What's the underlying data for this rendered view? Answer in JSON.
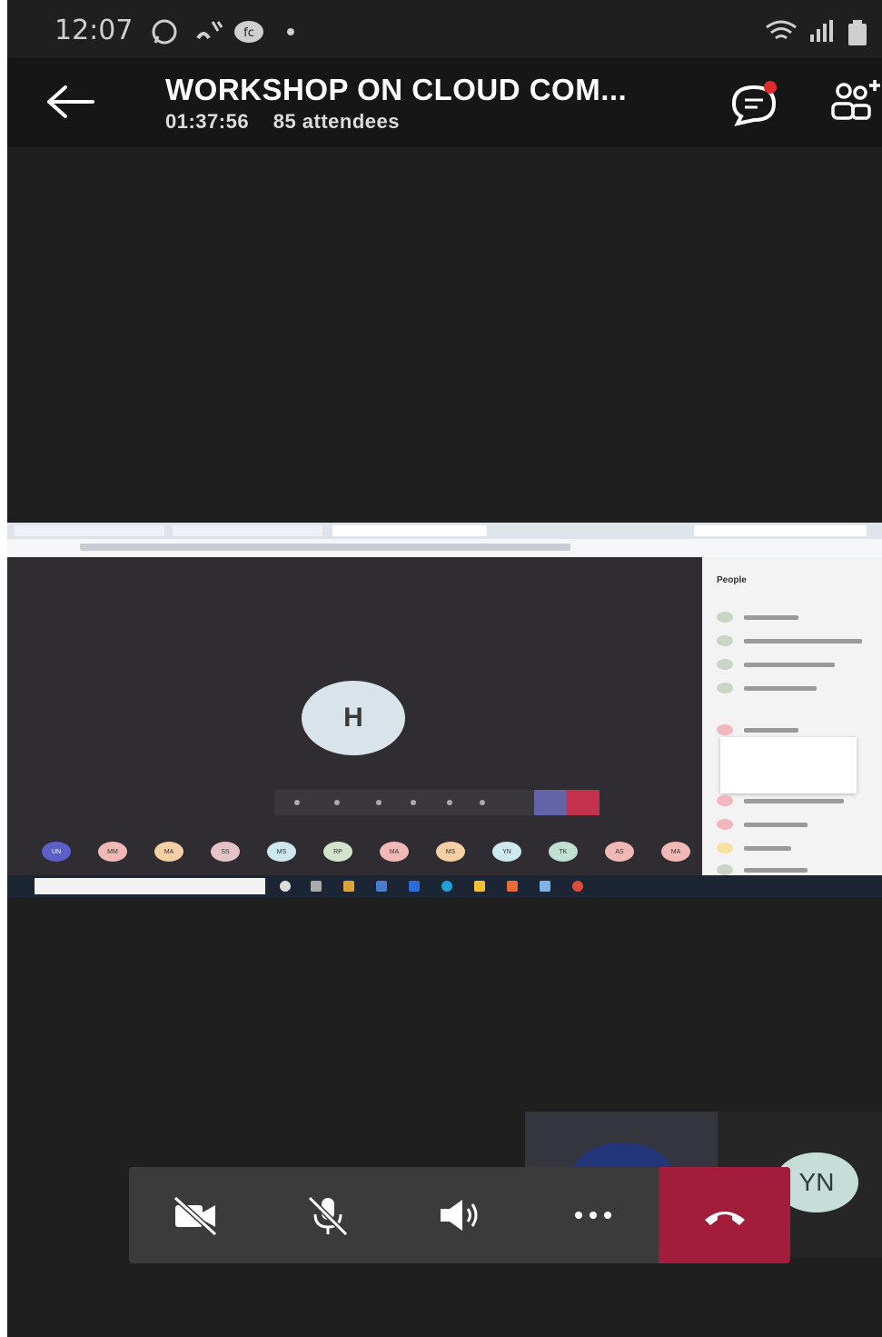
{
  "status_bar": {
    "time": "12:07",
    "icons": [
      "whatsapp-icon",
      "missed-call-icon",
      "fb-icon",
      "dot-icon",
      "wifi-icon",
      "signal-icon",
      "battery-icon"
    ]
  },
  "header": {
    "title": "WORKSHOP ON CLOUD COM...",
    "duration": "01:37:56",
    "attendees": "85 attendees",
    "icons": [
      "back-arrow-icon",
      "chat-icon",
      "add-people-icon"
    ],
    "chat_badge_color": "#e02b2b"
  },
  "shared_screen": {
    "presenter_initial": "H",
    "attendee_initials": [
      "UN",
      "MM",
      "MA",
      "SS",
      "MS",
      "RP",
      "MA",
      "MS",
      "YN",
      "TK",
      "AS",
      "MA"
    ],
    "attendee_colors": [
      "#5b5fc7",
      "#f2b8b5",
      "#f6cfa5",
      "#e7c2c7",
      "#cde8ee",
      "#d4e4cc",
      "#f2b8b5",
      "#f6cfa5",
      "#cde8ee",
      "#bfe0d2",
      "#f2b8b5",
      "#f2b8b5"
    ],
    "people_panel_title": "People"
  },
  "self_view": {
    "initials": "YN"
  },
  "controls": {
    "buttons": [
      "camera-off-icon",
      "mic-off-icon",
      "speaker-icon",
      "more-icon",
      "hang-up-icon"
    ],
    "hangup_color": "#a11d3b",
    "bar_color": "#3b3b3c"
  }
}
